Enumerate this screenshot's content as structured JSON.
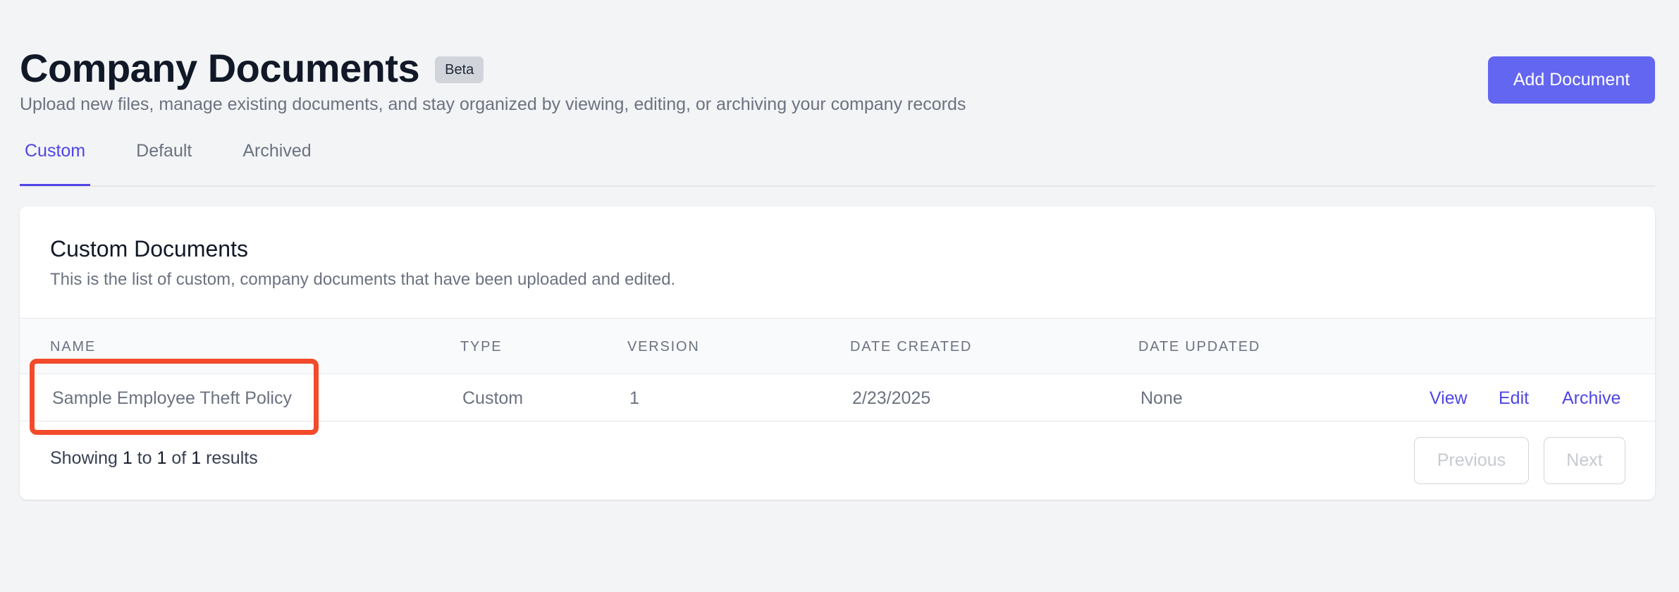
{
  "header": {
    "title": "Company Documents",
    "badge": "Beta",
    "subtitle": "Upload new files, manage existing documents, and stay organized by viewing, editing, or archiving your company records",
    "add_button": "Add Document"
  },
  "tabs": [
    {
      "label": "Custom",
      "active": true
    },
    {
      "label": "Default",
      "active": false
    },
    {
      "label": "Archived",
      "active": false
    }
  ],
  "card": {
    "title": "Custom Documents",
    "description": "This is the list of custom, company documents that have been uploaded and edited."
  },
  "table": {
    "columns": [
      "NAME",
      "TYPE",
      "VERSION",
      "DATE CREATED",
      "DATE UPDATED"
    ],
    "rows": [
      {
        "name": "Sample Employee Theft Policy",
        "type": "Custom",
        "version": "1",
        "date_created": "2/23/2025",
        "date_updated": "None",
        "actions": {
          "view": "View",
          "edit": "Edit",
          "archive": "Archive"
        }
      }
    ]
  },
  "pagination": {
    "showing": "Showing",
    "from": "1",
    "to_word": "to",
    "to": "1",
    "of_word": "of",
    "total": "1",
    "results_word": "results",
    "previous": "Previous",
    "next": "Next"
  },
  "colors": {
    "accent": "#6366f1",
    "active_tab": "#4f46e5",
    "highlight_box": "#f24a2a",
    "background": "#f3f4f6"
  }
}
